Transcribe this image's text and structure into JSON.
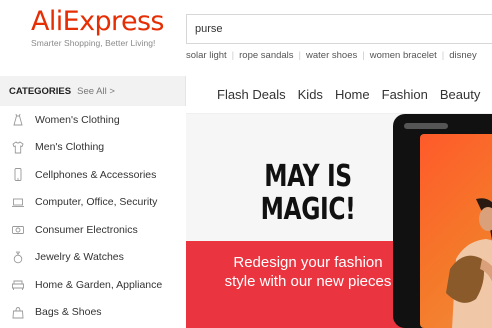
{
  "header": {
    "logo_text": "AliExpress",
    "logo_tagline": "Smarter Shopping, Better Living!",
    "search_value": "purse",
    "hot_keywords": [
      "solar light",
      "rope sandals",
      "water shoes",
      "women bracelet",
      "disney"
    ]
  },
  "sidebar": {
    "title": "CATEGORIES",
    "see_all": "See All >",
    "items": [
      {
        "label": "Women's Clothing",
        "icon": "dress-icon"
      },
      {
        "label": "Men's Clothing",
        "icon": "shirt-icon"
      },
      {
        "label": "Cellphones & Accessories",
        "icon": "phone-icon"
      },
      {
        "label": "Computer, Office, Security",
        "icon": "laptop-icon"
      },
      {
        "label": "Consumer Electronics",
        "icon": "camera-icon"
      },
      {
        "label": "Jewelry & Watches",
        "icon": "ring-icon"
      },
      {
        "label": "Home & Garden, Appliance",
        "icon": "sofa-icon"
      },
      {
        "label": "Bags & Shoes",
        "icon": "bag-icon"
      }
    ]
  },
  "nav": {
    "items": [
      "Flash Deals",
      "Kids",
      "Home",
      "Fashion",
      "Beauty"
    ]
  },
  "banner": {
    "headline_line1": "MAY IS",
    "headline_line2": "MAGIC!",
    "subtitle_line1": "Redesign your fashion",
    "subtitle_line2": "style with our new pieces"
  },
  "colors": {
    "brand": "#e62e04",
    "banner_red": "#ea3540"
  }
}
